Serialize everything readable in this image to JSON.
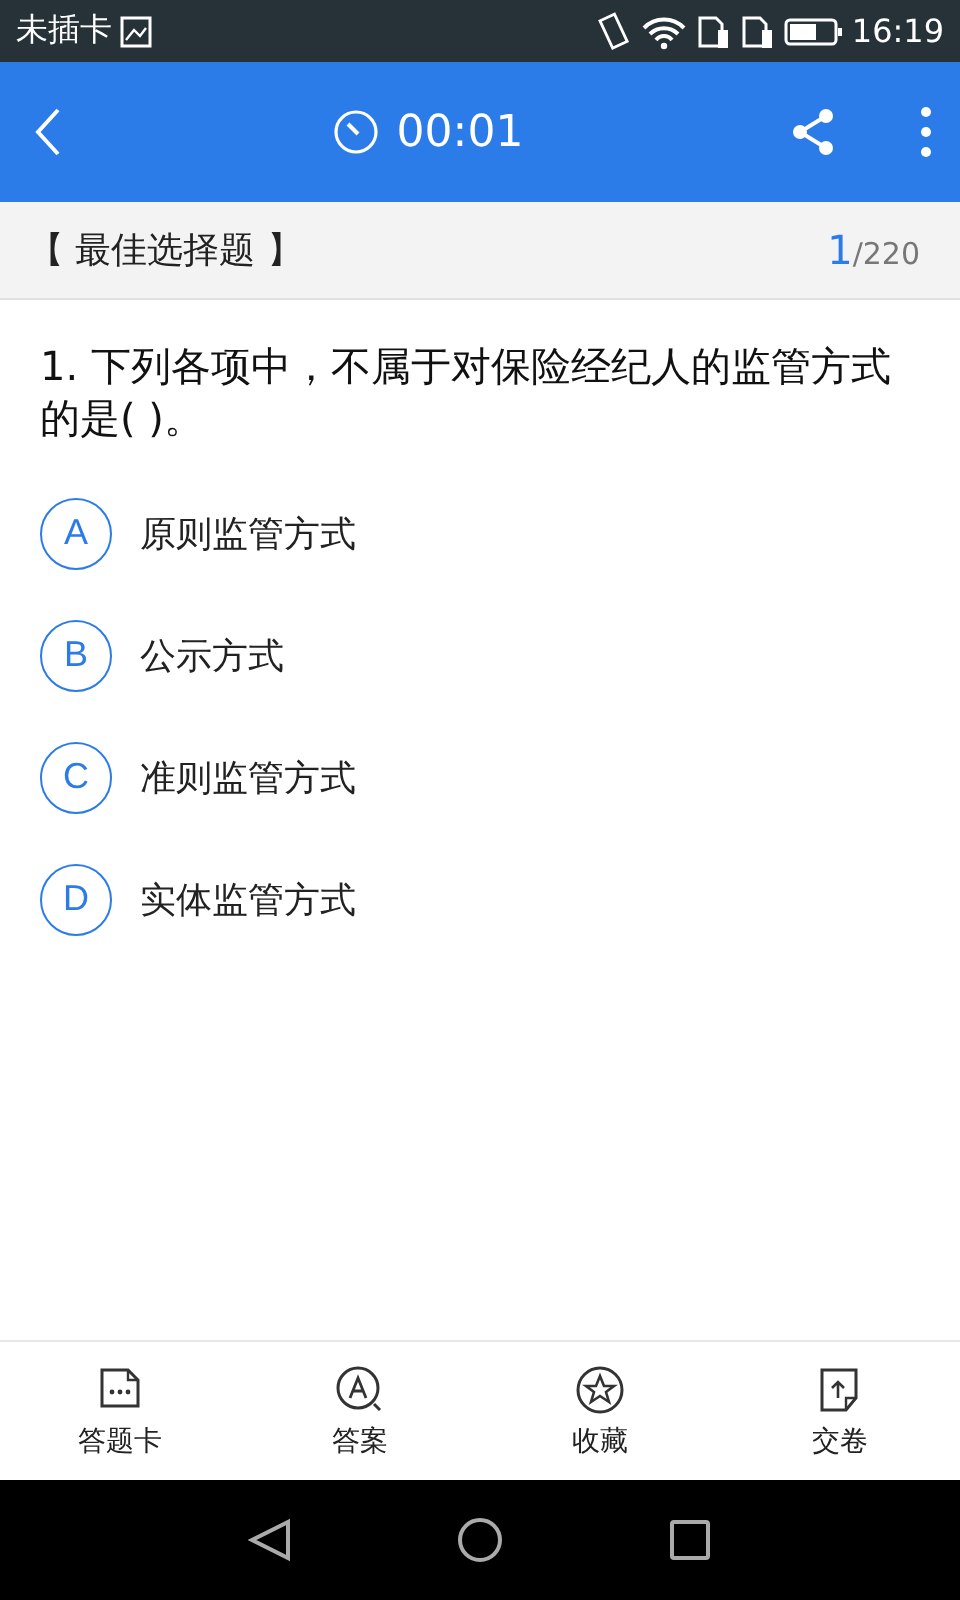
{
  "status_bar": {
    "carrier": "未插卡",
    "time": "16:19"
  },
  "app_bar": {
    "timer": "00:01"
  },
  "section": {
    "title": "【 最佳选择题 】",
    "current": "1",
    "total": "/220"
  },
  "question": {
    "text": "1. 下列各项中，不属于对保险经纪人的监管方式的是(    )。"
  },
  "options": [
    {
      "letter": "A",
      "text": "原则监管方式",
      "selected": false
    },
    {
      "letter": "B",
      "text": "公示方式",
      "selected": false
    },
    {
      "letter": "C",
      "text": "准则监管方式",
      "selected": false
    },
    {
      "letter": "D",
      "text": "实体监管方式",
      "selected": false
    }
  ],
  "bottom_bar": [
    {
      "kind": "card",
      "label": "答题卡"
    },
    {
      "kind": "answer",
      "label": "答案"
    },
    {
      "kind": "favorite",
      "label": "收藏"
    },
    {
      "kind": "submit",
      "label": "交卷"
    }
  ]
}
